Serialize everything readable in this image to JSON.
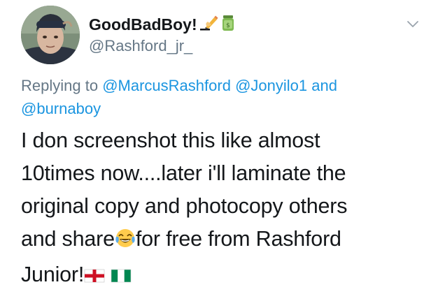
{
  "user": {
    "display_name": "GoodBadBoy!",
    "handle": "@Rashford_jr_",
    "name_emojis": [
      "writing-hand-icon",
      "money-jar-icon"
    ]
  },
  "reply": {
    "prefix": "Replying to",
    "mention_1": "@MarcusRashford",
    "mention_2": "@Jonyilo1",
    "connector": "and",
    "mention_3": "@burnaboy"
  },
  "tweet": {
    "line_1": "I don screenshot this like almost",
    "line_2": "10times now....later i'll laminate the",
    "line_3": "original copy and photocopy others",
    "line_4a": "and share",
    "line_4b": "for free from Rashford",
    "line_5": "Junior!",
    "emojis": [
      "laughing-tears-icon",
      "england-flag-icon",
      "nigeria-flag-icon"
    ]
  },
  "colors": {
    "text": "#14171a",
    "secondary": "#657786",
    "link": "#1b95e0"
  }
}
